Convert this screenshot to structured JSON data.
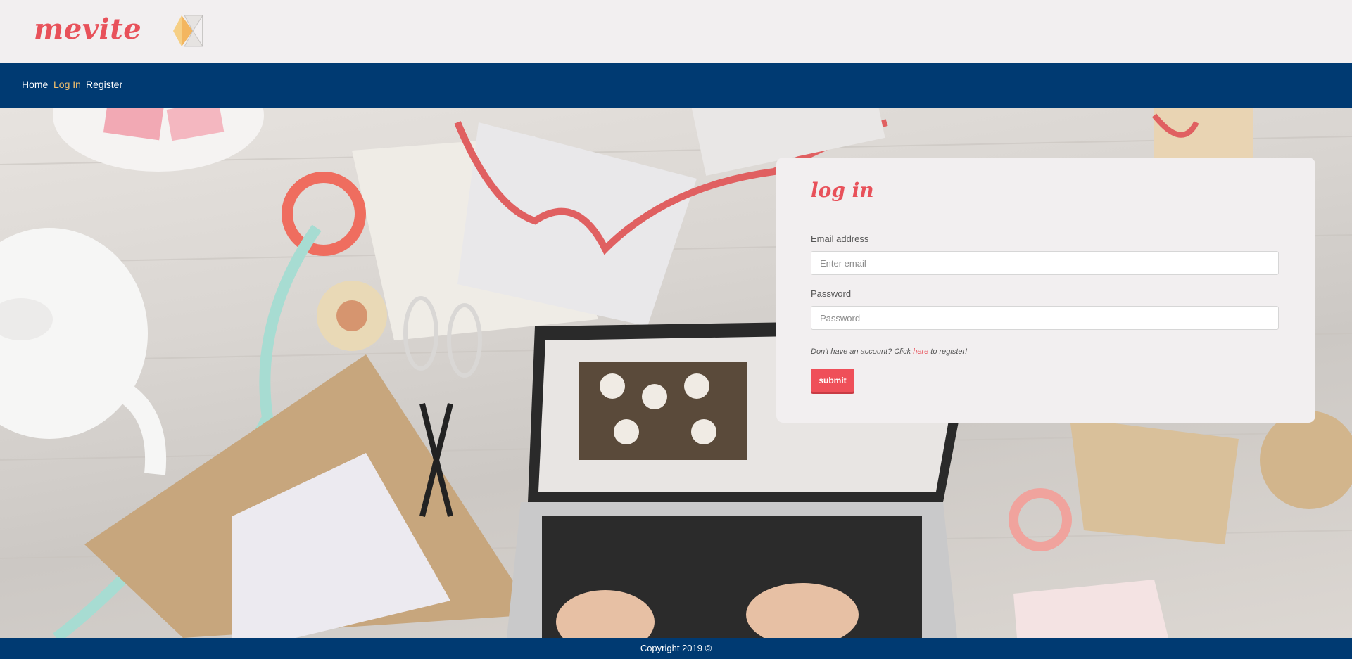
{
  "brand": {
    "name": "mevite"
  },
  "nav": {
    "items": [
      {
        "label": "Home",
        "active": false
      },
      {
        "label": "Log In",
        "active": true
      },
      {
        "label": "Register",
        "active": false
      }
    ]
  },
  "login": {
    "title": "log in",
    "email_label": "Email address",
    "email_placeholder": "Enter email",
    "email_value": "",
    "password_label": "Password",
    "password_placeholder": "Password",
    "password_value": "",
    "note_prefix": "Don't have an account? Click ",
    "note_link": "here",
    "note_suffix": " to register!",
    "submit_label": "submit"
  },
  "footer": {
    "copyright": "Copyright 2019 ©"
  },
  "colors": {
    "brand": "#e8515a",
    "navbar": "#003a72",
    "nav_active": "#f5c16c",
    "background": "#f2eff0"
  }
}
